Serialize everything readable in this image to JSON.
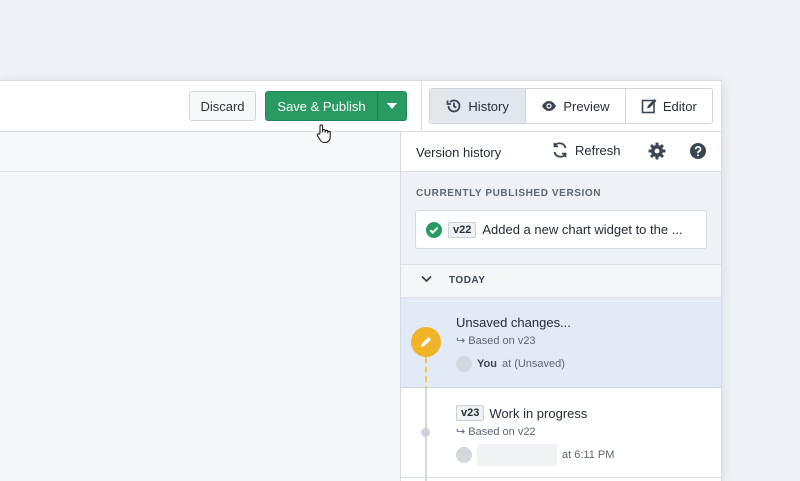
{
  "toolbar": {
    "discard_label": "Discard",
    "publish_label": "Save & Publish",
    "tabs": [
      {
        "label": "History",
        "icon": "history-icon",
        "active": true
      },
      {
        "label": "Preview",
        "icon": "eye-icon",
        "active": false
      },
      {
        "label": "Editor",
        "icon": "edit-icon",
        "active": false
      }
    ]
  },
  "sidebar": {
    "title": "Version history",
    "refresh_label": "Refresh",
    "published_heading": "CURRENTLY PUBLISHED VERSION",
    "published": {
      "version": "v22",
      "text": "Added a new chart widget to the ..."
    },
    "group_label": "TODAY",
    "entries": [
      {
        "title": "Unsaved changes...",
        "based_on": "Based on v23",
        "user": "You",
        "time": "at (Unsaved)"
      },
      {
        "version": "v23",
        "title": "Work in progress",
        "based_on": "Based on v22",
        "time": "at 6:11 PM"
      }
    ]
  },
  "colors": {
    "publish_green": "#2a9a63",
    "pending_yellow": "#f0b429",
    "selected_row": "#e2eaf8"
  }
}
